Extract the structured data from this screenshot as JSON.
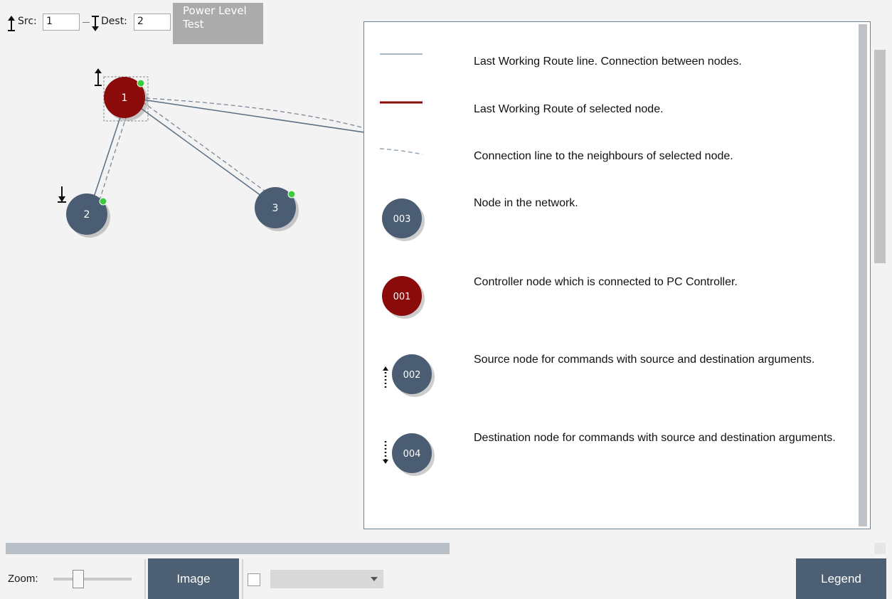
{
  "toolbar": {
    "src_label": "Src:",
    "src_value": "1",
    "dest_label": "Dest:",
    "dest_value": "2",
    "power_level_label": "Power Level Test",
    "src_icon": "source-arrow-icon",
    "dest_icon": "destination-arrow-icon"
  },
  "network": {
    "nodes": [
      {
        "id": "1",
        "kind": "controller",
        "selected": true,
        "source": true,
        "status": "online"
      },
      {
        "id": "2",
        "kind": "node",
        "destination": true,
        "status": "online"
      },
      {
        "id": "3",
        "kind": "node",
        "status": "online"
      }
    ],
    "colors": {
      "controller": "#8b0a0a",
      "node": "#4a5d72",
      "route_line": "#5a6e83",
      "status_online": "#3ccb3c"
    }
  },
  "legend": {
    "items": [
      {
        "symbol": "route-line",
        "text": "Last Working Route line. Connection between nodes."
      },
      {
        "symbol": "selected-route-line",
        "text": "Last Working Route of selected node."
      },
      {
        "symbol": "neighbour-dashed-line",
        "text": "Connection line to the neighbours of selected node."
      },
      {
        "symbol": "node",
        "label": "003",
        "text": "Node in the network."
      },
      {
        "symbol": "controller-node",
        "label": "001",
        "text": "Controller node which is connected to PC Controller."
      },
      {
        "symbol": "source-node",
        "label": "002",
        "text": "Source node for commands with source and destination arguments."
      },
      {
        "symbol": "destination-node",
        "label": "004",
        "text": "Destination node for commands with source and destination arguments."
      }
    ]
  },
  "bottom": {
    "zoom_label": "Zoom:",
    "image_button": "Image",
    "legend_button": "Legend",
    "checkbox_checked": false,
    "dropdown_value": ""
  }
}
